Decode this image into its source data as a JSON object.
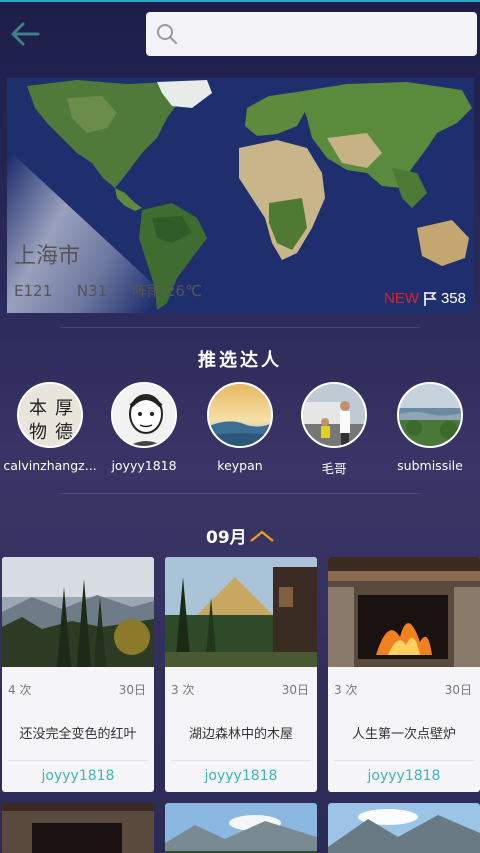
{
  "header": {
    "search_placeholder": "",
    "back_icon": "arrow-left-icon",
    "search_icon": "search-icon"
  },
  "location": {
    "city": "上海市",
    "longitude": "E121",
    "latitude": "N31",
    "weather": "阵雨",
    "temperature": "26℃",
    "new_label": "NEW",
    "flag_count": "358"
  },
  "recommend": {
    "title": "推选达人",
    "experts": [
      {
        "name": "calvinzhangz..."
      },
      {
        "name": "joyyy1818"
      },
      {
        "name": "keypan"
      },
      {
        "name": "毛哥"
      },
      {
        "name": "submissile"
      }
    ]
  },
  "timeline": {
    "month": "09月"
  },
  "cards": [
    {
      "views": "4 次",
      "day": "30日",
      "title": "还没完全变色的红叶",
      "author": "joyyy1818"
    },
    {
      "views": "3 次",
      "day": "30日",
      "title": "湖边森林中的木屋",
      "author": "joyyy1818"
    },
    {
      "views": "3 次",
      "day": "30日",
      "title": "人生第一次点壁炉",
      "author": "joyyy1818"
    }
  ],
  "colors": {
    "accent_teal": "#3db5ba",
    "new_red": "#d3242f",
    "chevron_orange": "#f0a020"
  }
}
